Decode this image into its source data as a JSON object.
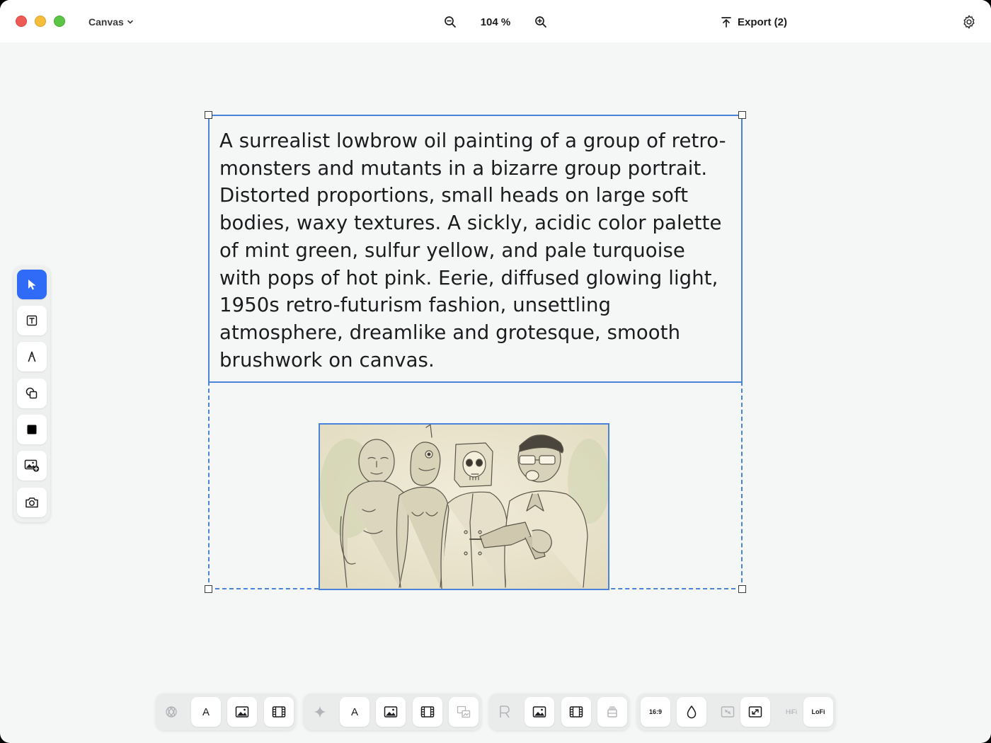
{
  "titlebar": {
    "document_menu_label": "Canvas",
    "zoom_value": "104 %",
    "export_label": "Export (2)"
  },
  "canvas": {
    "prompt_text": "A surrealist lowbrow oil painting of a group of retro-monsters and mutants in a bizarre group portrait. Distorted proportions, small heads on large soft bodies, waxy textures. A sickly, acidic color palette of mint green, sulfur yellow, and pale turquoise with pops of hot pink. Eerie, diffused glowing light, 1950s retro-futurism fashion, unsettling atmosphere, dreamlike and grotesque, smooth brushwork on canvas."
  },
  "left_toolbar": {
    "tools": [
      "select",
      "text",
      "pen",
      "shapes",
      "fill-color",
      "add-image",
      "camera"
    ],
    "active_tool": "select"
  },
  "bottom_toolbar": {
    "group1_text_label": "A",
    "group2_text_label": "A",
    "aspect_ratio_label": "16:9",
    "hifi_label": "HiFi",
    "lofi_label": "LoFi"
  },
  "colors": {
    "accent": "#2f6bf6",
    "selection": "#4b83d9",
    "canvas_bg": "#f5f7f7"
  }
}
